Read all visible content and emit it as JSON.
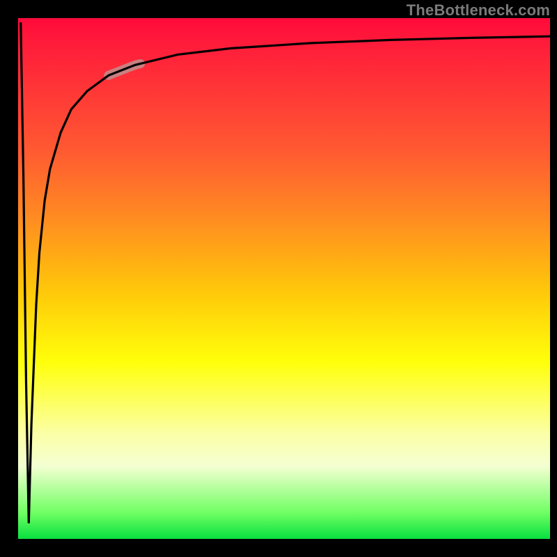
{
  "watermark": "TheBottleneck.com",
  "colors": {
    "frame": "#000000",
    "gradient_top": "#ff0a3a",
    "gradient_bottom": "#08e040",
    "curve": "#000000",
    "marker": "#c98080"
  },
  "chart_data": {
    "type": "line",
    "title": "",
    "xlabel": "",
    "ylabel": "",
    "xlim": [
      0,
      100
    ],
    "ylim": [
      0,
      100
    ],
    "grid": false,
    "legend": null,
    "series": [
      {
        "name": "bottleneck-curve",
        "x": [
          0.5,
          1.0,
          1.5,
          2.0,
          2.5,
          3.4,
          4.0,
          5.0,
          6.0,
          8.0,
          10.0,
          13.0,
          17.0,
          22.0,
          30.0,
          40.0,
          55.0,
          70.0,
          85.0,
          100.0
        ],
        "y": [
          99.0,
          70.0,
          30.0,
          3.0,
          22.0,
          45.0,
          55.0,
          65.0,
          71.0,
          78.0,
          82.5,
          86.0,
          89.0,
          91.0,
          93.0,
          94.2,
          95.2,
          95.8,
          96.2,
          96.5
        ]
      }
    ],
    "marker": {
      "series": "bottleneck-curve",
      "x_range": [
        17,
        23
      ],
      "y_range": [
        78,
        83
      ],
      "color": "#c98080",
      "note": "highlighted segment on the ascending branch"
    },
    "note": "y expressed as percent of plot height from bottom; data read off pixels, approximate"
  }
}
